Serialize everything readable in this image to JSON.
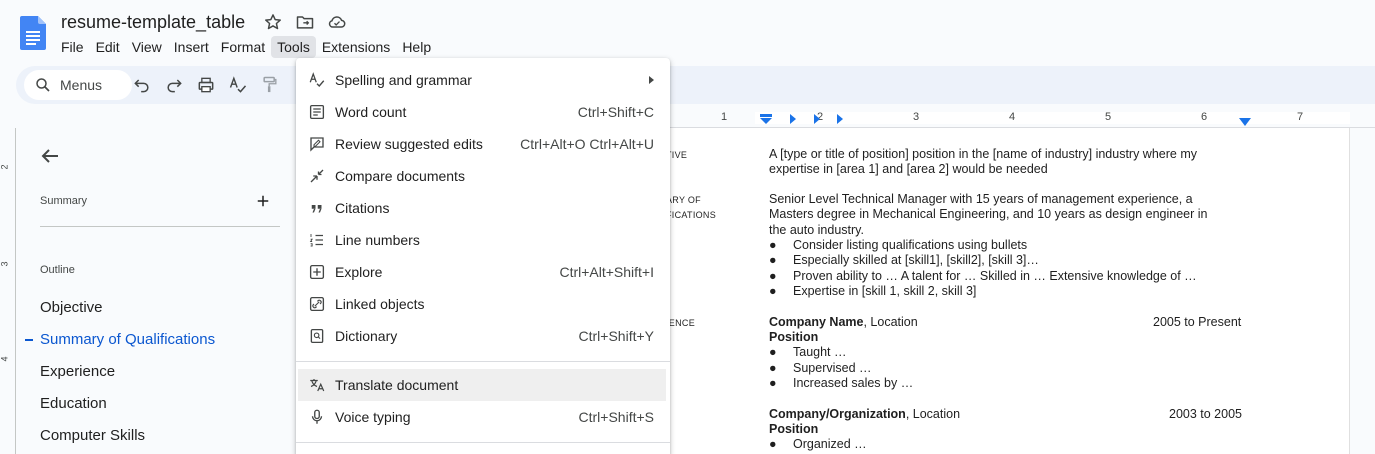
{
  "doc": {
    "title": "resume-template_table"
  },
  "menubar": {
    "items": [
      "File",
      "Edit",
      "View",
      "Insert",
      "Format",
      "Tools",
      "Extensions",
      "Help"
    ],
    "active": "Tools"
  },
  "toolbar": {
    "search_placeholder": "Menus"
  },
  "ruler": {
    "numbers": [
      "1",
      "2",
      "3",
      "4",
      "5",
      "6",
      "7"
    ],
    "vertical_numbers": [
      "2",
      "3",
      "4"
    ]
  },
  "outline_panel": {
    "summary_label": "Summary",
    "outline_label": "Outline",
    "items": [
      "Objective",
      "Summary of Qualifications",
      "Experience",
      "Education",
      "Computer Skills"
    ],
    "current_index": 1
  },
  "tools_menu": {
    "items": [
      {
        "label": "Spelling and grammar",
        "shortcut": "",
        "icon": "spellcheck-icon",
        "submenu": true
      },
      {
        "label": "Word count",
        "shortcut": "Ctrl+Shift+C",
        "icon": "word-count-icon"
      },
      {
        "label": "Review suggested edits",
        "shortcut": "Ctrl+Alt+O Ctrl+Alt+U",
        "icon": "review-edits-icon"
      },
      {
        "label": "Compare documents",
        "shortcut": "",
        "icon": "compare-icon"
      },
      {
        "label": "Citations",
        "shortcut": "",
        "icon": "quote-icon"
      },
      {
        "label": "Line numbers",
        "shortcut": "",
        "icon": "line-numbers-icon"
      },
      {
        "label": "Explore",
        "shortcut": "Ctrl+Alt+Shift+I",
        "icon": "explore-icon"
      },
      {
        "label": "Linked objects",
        "shortcut": "",
        "icon": "link-icon"
      },
      {
        "label": "Dictionary",
        "shortcut": "Ctrl+Shift+Y",
        "icon": "dictionary-icon"
      },
      {
        "label": "Translate document",
        "shortcut": "",
        "icon": "translate-icon"
      },
      {
        "label": "Voice typing",
        "shortcut": "Ctrl+Shift+S",
        "icon": "microphone-icon"
      }
    ]
  },
  "document": {
    "sections": {
      "objective_label": "TIVE",
      "summary_label_1": "ARY OF",
      "summary_label_2": "FICATIONS",
      "experience_label": "IENCE"
    },
    "objective_line1": "A [type or title of position] position in the [name of industry] industry where my",
    "objective_line2": "expertise in [area 1] and [area 2] would be needed",
    "summary_line1": "Senior Level Technical Manager with 15 years of management experience, a",
    "summary_line2": "Masters degree in Mechanical Engineering, and 10 years as design engineer in",
    "summary_line3": "the auto industry.",
    "summary_bullets": [
      "Consider listing qualifications using bullets",
      "Especially skilled at [skill1], [skill2], [skill 3]…",
      "Proven ability to … A talent for … Skilled in … Extensive knowledge of …",
      "Expertise in [skill 1, skill 2, skill 3]"
    ],
    "job1": {
      "company": "Company Name",
      "location": ", Location",
      "dates": "2005 to Present",
      "position": "Position",
      "bullets": [
        "Taught …",
        "Supervised …",
        "Increased sales by …"
      ]
    },
    "job2": {
      "company": "Company/Organization",
      "location": ", Location",
      "dates": "2003 to 2005",
      "position": "Position",
      "bullets": [
        "Organized …"
      ]
    },
    "bullet_char": "●"
  }
}
